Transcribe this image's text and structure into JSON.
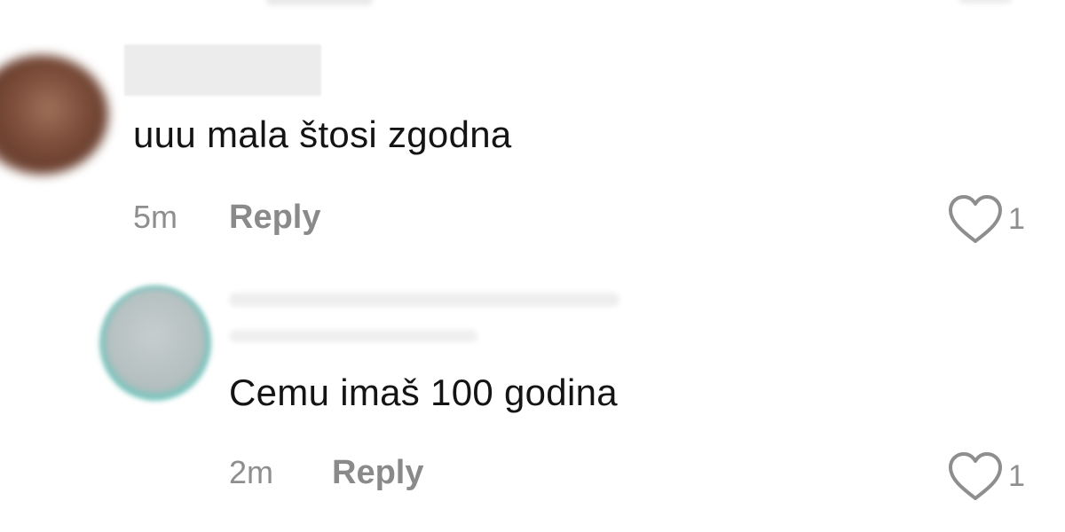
{
  "colors": {
    "text_primary": "#141414",
    "text_secondary": "#8e8e8e",
    "background": "#ffffff",
    "reply_avatar_ring": "#5ecfc5"
  },
  "comments": [
    {
      "text": "uuu mala štosi zgodna",
      "time": "5m",
      "reply_label": "Reply",
      "like_icon": "heart-outline-icon",
      "like_count": "1"
    },
    {
      "text": "Cemu imaš 100 godina",
      "time": "2m",
      "reply_label": "Reply",
      "like_icon": "heart-outline-icon",
      "like_count": "1"
    }
  ]
}
